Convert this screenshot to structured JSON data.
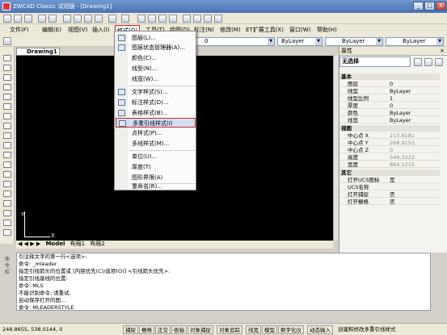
{
  "window": {
    "title": "ZWCAD Classic 试用版 - [Drawing1]",
    "buttons": [
      "_",
      "□",
      "X"
    ]
  },
  "menubar": {
    "items": [
      "文件(F)",
      "编辑(E)",
      "视图(V)",
      "插入(I)",
      "格式(O)",
      "工具(T)",
      "绘图(D)",
      "标注(N)",
      "修改(M)",
      "ET扩展工具(X)",
      "窗口(W)",
      "帮助(H)"
    ],
    "active_index": 4
  },
  "toolbar2": {
    "layer_value": "0",
    "color_value": "ByLayer",
    "linetype_value": "ByLayer",
    "lineweight_value": "ByLayer"
  },
  "drawing_tab": "Drawing1",
  "ucs": {
    "x": "X",
    "y": "Y"
  },
  "layout_tabs": [
    "Model",
    "布局1",
    "布局2"
  ],
  "format_menu": [
    {
      "label": "图层(L)...",
      "icon": "layer-icon"
    },
    {
      "label": "图层状态管理器(A)...",
      "icon": "layer-state-icon"
    },
    {
      "label": "颜色(C)..."
    },
    {
      "label": "线型(N)..."
    },
    {
      "label": "线宽(W)..."
    },
    {
      "label": "文字样式(S)...",
      "icon": "text-style-icon"
    },
    {
      "label": "标注样式(D)...",
      "icon": "dim-style-icon"
    },
    {
      "label": "表格样式(B)...",
      "icon": "table-style-icon"
    },
    {
      "label": "多重引线样式(I)",
      "icon": "mleader-style-icon",
      "highlighted": true
    },
    {
      "label": "点样式(P)..."
    },
    {
      "label": "多线样式(M)..."
    },
    {
      "label": "单位(U)..."
    },
    {
      "label": "厚度(T)"
    },
    {
      "label": "图形界限(A)"
    },
    {
      "label": "重命名(R)..."
    }
  ],
  "properties": {
    "panel_title": "属性",
    "selection": "无选择",
    "sections": [
      {
        "title": "基本",
        "rows": [
          [
            "图层",
            "0"
          ],
          [
            "线型",
            "ByLayer"
          ],
          [
            "线型比例",
            "1"
          ],
          [
            "厚度",
            "0"
          ],
          [
            "颜色",
            "ByLayer"
          ],
          [
            "线宽",
            "ByLayer"
          ]
        ]
      },
      {
        "title": "视图",
        "rows": [
          [
            "中心点 X",
            "213.6181"
          ],
          [
            "中心点 Y",
            "268.9153"
          ],
          [
            "中心点 Z",
            "0"
          ],
          [
            "高度",
            "546.3322"
          ],
          [
            "宽度",
            "864.1215"
          ]
        ]
      },
      {
        "title": "其它",
        "rows": [
          [
            "打开UCS图标",
            "是"
          ],
          [
            "UCS名称",
            ""
          ],
          [
            "打开捕捉",
            "否"
          ],
          [
            "打开栅格",
            "否"
          ]
        ]
      }
    ]
  },
  "command_label": "命令栏",
  "command_lines": [
    "引注释文字的第一行<选项>:",
    "命令: _mleader",
    "指定引线箭头的位置或 [内容优先(C)/选项(O)] <引线箭头优先>:",
    "指定引线基线的位置:",
    "命令: MLS",
    "不能识别命令, 请重试.",
    "自动保存打开的图...",
    "命令: MLEADERSTYLE"
  ],
  "statusbar": {
    "coords": "248.8655, 538.0144, 0",
    "toggles": [
      "捕捉",
      "栅格",
      "正交",
      "极轴",
      "对象捕捉",
      "对象追踪",
      "线宽",
      "模型",
      "数字化仪",
      "动态输入"
    ],
    "hint": "创建和修改多重引线样式"
  }
}
